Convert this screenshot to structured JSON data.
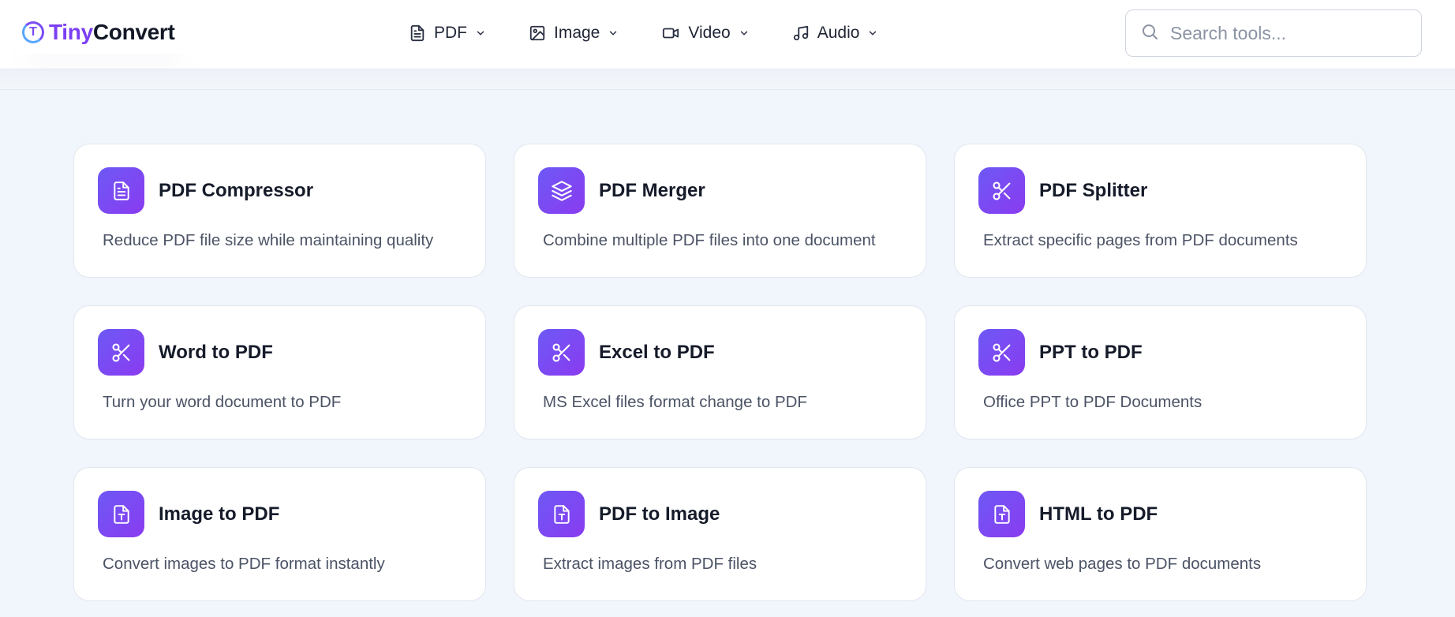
{
  "header": {
    "logo": {
      "tiny": "Tiny",
      "convert": "Convert",
      "mark": "T"
    },
    "nav": [
      {
        "label": "PDF",
        "icon": "file-icon"
      },
      {
        "label": "Image",
        "icon": "image-icon"
      },
      {
        "label": "Video",
        "icon": "video-icon"
      },
      {
        "label": "Audio",
        "icon": "music-icon"
      }
    ],
    "search": {
      "placeholder": "Search tools..."
    }
  },
  "tools": [
    {
      "title": "PDF Compressor",
      "desc": "Reduce PDF file size while maintaining quality",
      "icon": "file-text-icon"
    },
    {
      "title": "PDF Merger",
      "desc": "Combine multiple PDF files into one document",
      "icon": "layers-icon"
    },
    {
      "title": "PDF Splitter",
      "desc": "Extract specific pages from PDF documents",
      "icon": "scissors-icon"
    },
    {
      "title": "Word to PDF",
      "desc": "Turn your word document to PDF",
      "icon": "scissors-icon"
    },
    {
      "title": "Excel to PDF",
      "desc": "MS Excel files format change to PDF",
      "icon": "scissors-icon"
    },
    {
      "title": "PPT to PDF",
      "desc": "Office PPT to PDF Documents",
      "icon": "scissors-icon"
    },
    {
      "title": "Image to PDF",
      "desc": "Convert images to PDF format instantly",
      "icon": "file-type-icon"
    },
    {
      "title": "PDF to Image",
      "desc": "Extract images from PDF files",
      "icon": "file-type-icon"
    },
    {
      "title": "HTML to PDF",
      "desc": "Convert web pages to PDF documents",
      "icon": "file-type-icon"
    }
  ],
  "colors": {
    "accent": "#7b3ff2",
    "icon_gradient_start": "#6d59f5",
    "icon_gradient_end": "#8a3bf0",
    "background": "#f1f5fc"
  }
}
